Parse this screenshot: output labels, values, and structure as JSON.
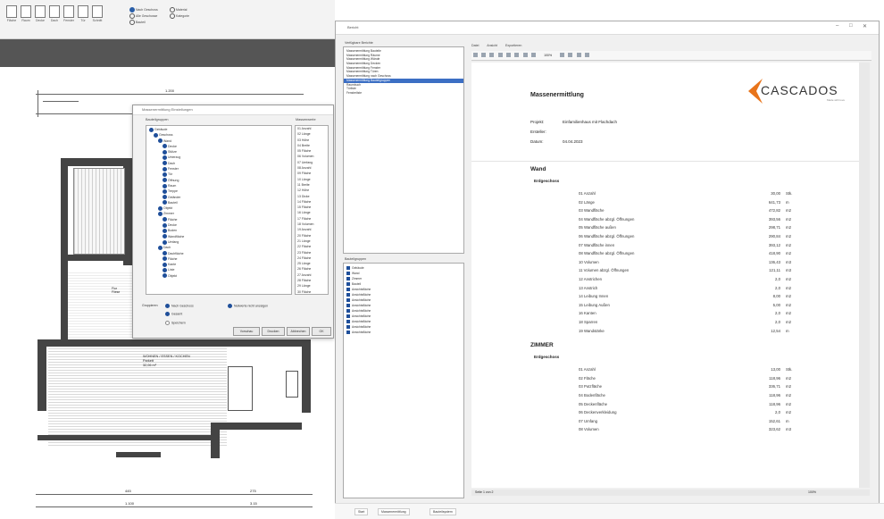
{
  "cad": {
    "ribbon_buttons": [
      "Fläche",
      "Raum",
      "Decke",
      "Dach",
      "Fenster",
      "Tür",
      "Schnitt"
    ],
    "ribbon_options": [
      "Nach Geschoss",
      "Alle Geschosse",
      "Bauteil",
      "Material",
      "Kategorie"
    ],
    "room_label": [
      "WOHNEN / ESSEN / KOCHEN",
      "Parkett",
      "32,06 m²"
    ],
    "dim_top": "1.200",
    "dim_bottom": [
      "445",
      "275",
      "1.100",
      "3.15"
    ]
  },
  "dialog": {
    "title": "Massenermittlung Einstellungen",
    "left_header": "Bauteilgruppen",
    "right_header": "Massenwerte",
    "tree": [
      "Gebäude",
      "Geschoss",
      "Wand",
      "Decke",
      "Stütze",
      "Unterzug",
      "Dach",
      "Fenster",
      "Tür",
      "Öffnung",
      "Raum",
      "Treppe",
      "Geländer",
      "Bauteil",
      "Objekt",
      "Zimmer",
      "Fläche",
      "Decke",
      "Boden",
      "Wandfläche",
      "Umfang",
      "Dach",
      "Dachfläche",
      "Fläche",
      "Kante",
      "Linie",
      "Objekt"
    ],
    "values": [
      "01 Anzahl",
      "02 Länge",
      "03 Höhe",
      "04 Breite",
      "05 Fläche",
      "06 Volumen",
      "07 Umfang",
      "08 Anzahl",
      "09 Fläche",
      "10 Länge",
      "11 Breite",
      "12 Höhe",
      "13 Dicke",
      "14 Fläche",
      "15 Fläche",
      "16 Länge",
      "17 Fläche",
      "18 Volumen",
      "19 Anzahl",
      "20 Fläche",
      "21 Länge",
      "22 Fläche",
      "23 Fläche",
      "24 Fläche",
      "25 Länge",
      "26 Fläche",
      "27 Anzahl",
      "28 Fläche",
      "29 Länge",
      "30 Fläche",
      "31 Länge"
    ],
    "options": [
      "Gruppieren",
      "Nach Geschoss",
      "Gesamt",
      "Speichern"
    ],
    "option_right": "Nullwerte nicht anzeigen",
    "buttons": [
      "Vorschau",
      "Drucken",
      "Abbrechen",
      "OK"
    ]
  },
  "report_window": {
    "title": "Bericht",
    "left_header": "Verfügbare Berichte",
    "reports": [
      "Massenermittlung Bauteile",
      "Massenermittlung Räume",
      "Massenermittlung Wände",
      "Massenermittlung Decken",
      "Massenermittlung Fenster",
      "Massenermittlung Türen",
      "Massenermittlung nach Geschoss",
      "Massenermittlung Bauteilgruppen",
      "Raumbuch",
      "Türliste",
      "Fensterliste"
    ],
    "selected_report": 7,
    "left_header2": "Bauteilgruppen",
    "groups": [
      "Gebäude",
      "Wand",
      "Zimmer",
      "Bauteil",
      "Ansichtsfläche",
      "Ansichtsfläche",
      "Ansichtsfläche",
      "Ansichtsfläche",
      "Ansichtsfläche",
      "Ansichtsfläche",
      "Ansichtsfläche",
      "Ansichtsfläche",
      "Ansichtsfläche"
    ],
    "menu": [
      "Datei",
      "Ansicht",
      "Exportieren"
    ],
    "zoom": "100%",
    "status": "Seite 1 von 2",
    "status_right": "100%"
  },
  "document": {
    "heading": "Massenermittlung",
    "logo_text": "CASCADOS",
    "logo_tag": "Made with love",
    "fields": [
      {
        "label": "Projekt:",
        "value": "Einfamilienhaus mit Flachdach"
      },
      {
        "label": "Ersteller:",
        "value": ""
      },
      {
        "label": "Datum:",
        "value": "04.04.2023"
      }
    ],
    "sections": [
      {
        "title": "Wand",
        "group": "Erdgeschoss",
        "rows": [
          {
            "name": "01 Anzahl",
            "value": "30,00",
            "unit": "Stk."
          },
          {
            "name": "02 Länge",
            "value": "641,73",
            "unit": "m"
          },
          {
            "name": "03 Wandfläche",
            "value": "472,82",
            "unit": "m2"
          },
          {
            "name": "04 Wandfläche abzgl. Öffnungen",
            "value": "393,56",
            "unit": "m2"
          },
          {
            "name": "05 Wandfläche außen",
            "value": "298,71",
            "unit": "m2"
          },
          {
            "name": "06 Wandfläche abzgl. Öffnungen",
            "value": "290,84",
            "unit": "m2"
          },
          {
            "name": "07 Wandfläche innen",
            "value": "393,12",
            "unit": "m2"
          },
          {
            "name": "08 Wandfläche abzgl. Öffnungen",
            "value": "418,90",
            "unit": "m2"
          },
          {
            "name": "10 Volumen",
            "value": "136,43",
            "unit": "m3"
          },
          {
            "name": "11 Volumen abzgl. Öffnungen",
            "value": "121,11",
            "unit": "m3"
          },
          {
            "name": "12 Anstrichen",
            "value": "2,0",
            "unit": "m2"
          },
          {
            "name": "13 Anstrich",
            "value": "2,0",
            "unit": "m2"
          },
          {
            "name": "14 Leibung Innen",
            "value": "8,00",
            "unit": "m2"
          },
          {
            "name": "15 Leibung Außen",
            "value": "5,00",
            "unit": "m2"
          },
          {
            "name": "16 Kanten",
            "value": "2,0",
            "unit": "m2"
          },
          {
            "name": "18 Sparren",
            "value": "2,0",
            "unit": "m2"
          },
          {
            "name": "19 Wandstärke",
            "value": "12,54",
            "unit": "m"
          }
        ]
      },
      {
        "title": "ZIMMER",
        "group": "Erdgeschoss",
        "rows": [
          {
            "name": "01 Anzahl",
            "value": "13,00",
            "unit": "Stk."
          },
          {
            "name": "02 Fläche",
            "value": "118,96",
            "unit": "m2"
          },
          {
            "name": "03 Putzfläche",
            "value": "336,71",
            "unit": "m2"
          },
          {
            "name": "04 Bodenfläche",
            "value": "118,96",
            "unit": "m2"
          },
          {
            "name": "05 Deckenfläche",
            "value": "118,96",
            "unit": "m2"
          },
          {
            "name": "06 Deckenverkleidung",
            "value": "2,0",
            "unit": "m2"
          },
          {
            "name": "07 Umfang",
            "value": "152,61",
            "unit": "m"
          },
          {
            "name": "08 Volumen",
            "value": "323,62",
            "unit": "m3"
          }
        ]
      }
    ]
  },
  "taskbar": [
    "Start",
    "Massenermittlung",
    "Bauteilsystem"
  ]
}
